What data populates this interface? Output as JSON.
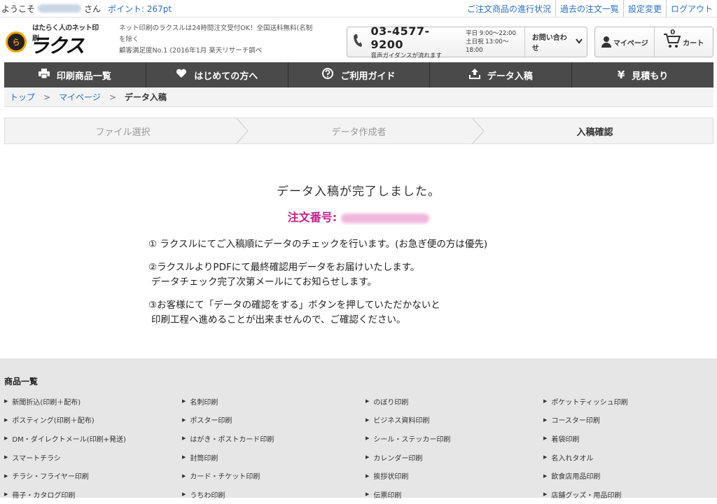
{
  "topbar": {
    "welcome": "ようこそ",
    "san": "さん",
    "points": "ポイント: 267pt",
    "links": [
      "ご注文商品の進行状況",
      "過去の注文一覧",
      "設定変更",
      "ログアウト"
    ]
  },
  "header": {
    "logo_sub": "はたらく人のネット印刷",
    "logo_name": "ラクスル",
    "tagline_1": "ネット印刷のラクスルは24時間注文受付OK！全国送料無料(名制",
    "tagline_2": "を除く",
    "tagline_3": "顧客満足度No.1 (2016年1月 楽天リサーチ調べ",
    "phone": "03-4577-9200",
    "phone_guide": "音声ガイダンスが流れます",
    "hours_weekday": "平日 9:00〜22:00",
    "hours_holiday": "土日祝 13:00〜18:00",
    "inquiry": "お問い合わせ",
    "mypage": "マイページ",
    "cart": "カート",
    "cart_count": "0"
  },
  "nav": [
    {
      "label": "印刷商品一覧",
      "icon": "printer-icon"
    },
    {
      "label": "はじめての方へ",
      "icon": "heart-icon"
    },
    {
      "label": "ご利用ガイド",
      "icon": "question-icon"
    },
    {
      "label": "データ入稿",
      "icon": "upload-icon"
    },
    {
      "label": "見積もり",
      "icon": "yen-icon"
    }
  ],
  "breadcrumb": {
    "top": "トップ",
    "mypage": "マイページ",
    "current": "データ入稿",
    "sep": ">"
  },
  "steps": [
    "ファイル選択",
    "データ作成者",
    "入稿確認"
  ],
  "main": {
    "title": "データ入稿が完了しました。",
    "order_label": "注文番号:",
    "note1": "① ラクスルにてご入稿順にデータのチェックを行います。(お急ぎ便の方は優先)",
    "note2a": "②ラクスルよりPDFにて最終確認用データをお届けいたします。",
    "note2b": "データチェック完了次第メールにてお知らせします。",
    "note3a": "③お客様にて「データの確認をする」ボタンを押していただかないと",
    "note3b": "印刷工程へ進めることが出来ませんので、ご確認ください。"
  },
  "footer": {
    "heading": "商品一覧",
    "items": [
      "新聞折込(印刷＋配布)",
      "名刺印刷",
      "のぼり印刷",
      "ポケットティッシュ印刷",
      "ポスティング(印刷＋配布)",
      "ポスター印刷",
      "ビジネス資料印刷",
      "コースター印刷",
      "DM・ダイレクトメール(印刷+発送)",
      "はがき・ポストカード印刷",
      "シール・ステッカー印刷",
      "着袋印刷",
      "スマートチラシ",
      "封筒印刷",
      "カレンダー印刷",
      "名入れタオル",
      "チラシ・フライヤー印刷",
      "カード・チケット印刷",
      "挨拶状印刷",
      "飲食店用品印刷",
      "冊子・カタログ印刷",
      "うちわ印刷",
      "伝票印刷",
      "店舗グッズ・用品印刷"
    ]
  },
  "colors": {
    "link": "#2a6fc6",
    "nav_bg": "#4a4a4a",
    "order": "#c5218a",
    "footer_bg": "#e6e6e6"
  }
}
